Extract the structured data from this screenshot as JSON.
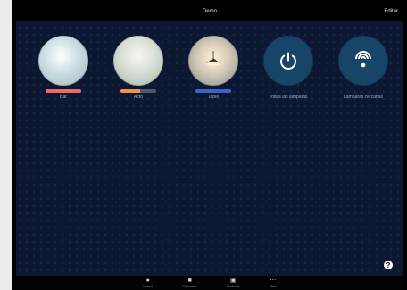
{
  "header": {
    "title": "Demo",
    "edit_label": "Editar"
  },
  "tiles": [
    {
      "label": "Bar",
      "bar_color": "#ef6a67",
      "bar_fill": 1.0,
      "icon": "bar-room-photo"
    },
    {
      "label": "Acto",
      "bar_color": "#f2904d",
      "bar_fill": 0.55,
      "icon": "acto-room-photo"
    },
    {
      "label": "Table",
      "bar_color": "#3e62c8",
      "bar_fill": 1.0,
      "icon": "table-room-photo"
    },
    {
      "label": "Todas las lámparas",
      "icon": "power-icon"
    },
    {
      "label": "Lámparas cercanas",
      "icon": "wireless-icon"
    }
  ],
  "help": {
    "label": "?"
  },
  "bottom_nav": [
    {
      "label": "Luces",
      "icon": "bulb-icon"
    },
    {
      "label": "Escenas",
      "icon": "scene-icon"
    },
    {
      "label": "Rutinas",
      "icon": "calendar-icon"
    },
    {
      "label": "Más",
      "icon": "more-icon"
    }
  ]
}
